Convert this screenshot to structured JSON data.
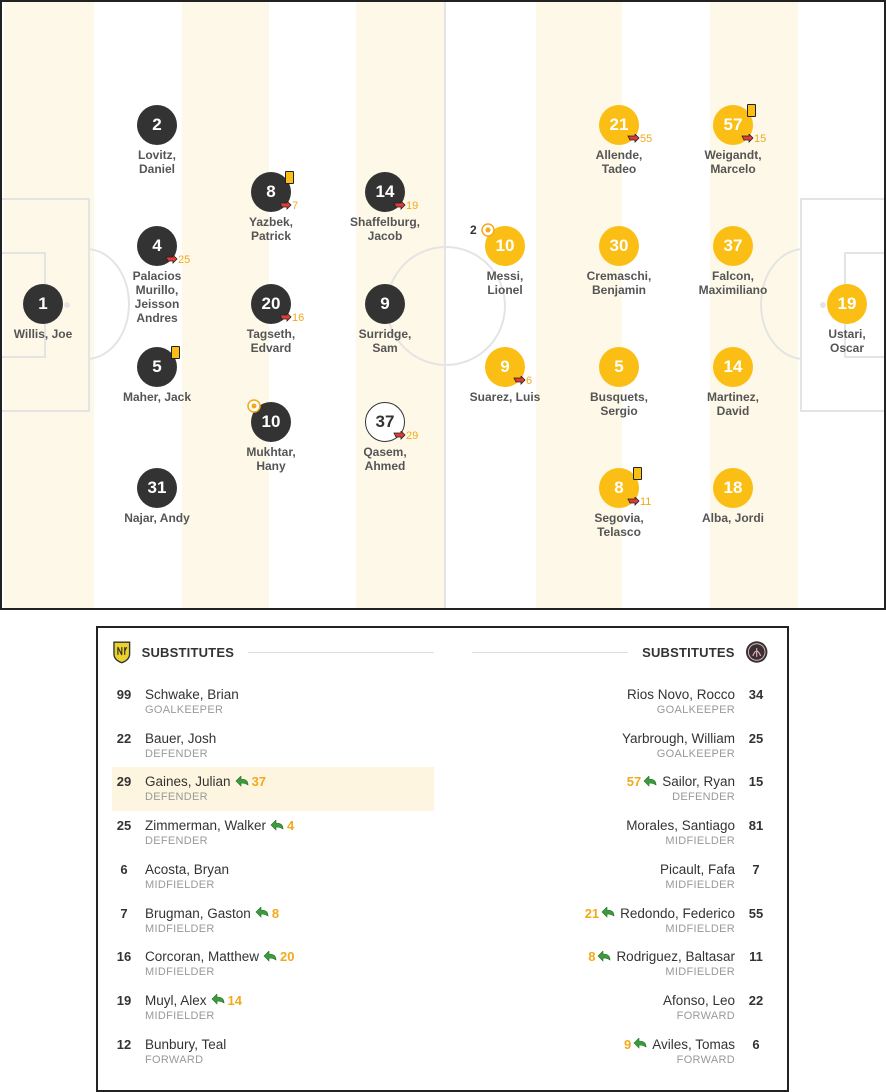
{
  "home_players": [
    {
      "number": "1",
      "name1": "Willis, Joe",
      "name2": ""
    },
    {
      "number": "2",
      "name1": "Lovitz,",
      "name2": "Daniel"
    },
    {
      "number": "4",
      "name1": "Palacios",
      "name2": "Murillo,",
      "name3": "Jeisson",
      "name4": "Andres",
      "sub_out": "25"
    },
    {
      "number": "5",
      "name1": "Maher, Jack",
      "name2": ""
    },
    {
      "number": "31",
      "name1": "Najar, Andy",
      "name2": ""
    },
    {
      "number": "8",
      "name1": "Yazbek,",
      "name2": "Patrick",
      "sub_out": "7"
    },
    {
      "number": "20",
      "name1": "Tagseth,",
      "name2": "Edvard",
      "sub_out": "16"
    },
    {
      "number": "10",
      "name1": "Mukhtar,",
      "name2": "Hany"
    },
    {
      "number": "14",
      "name1": "Shaffelburg,",
      "name2": "Jacob",
      "sub_out": "19"
    },
    {
      "number": "9",
      "name1": "Surridge,",
      "name2": "Sam"
    },
    {
      "number": "37",
      "name1": "Qasem,",
      "name2": "Ahmed",
      "sub_out": "29"
    }
  ],
  "away_players": [
    {
      "number": "10",
      "name1": "Messi,",
      "name2": "Lionel",
      "goals": "2"
    },
    {
      "number": "9",
      "name1": "Suarez, Luis",
      "name2": "",
      "sub_out": "6"
    },
    {
      "number": "21",
      "name1": "Allende,",
      "name2": "Tadeo",
      "sub_out": "55"
    },
    {
      "number": "30",
      "name1": "Cremaschi,",
      "name2": "Benjamin"
    },
    {
      "number": "5",
      "name1": "Busquets,",
      "name2": "Sergio"
    },
    {
      "number": "8",
      "name1": "Segovia,",
      "name2": "Telasco",
      "sub_out": "11"
    },
    {
      "number": "57",
      "name1": "Weigandt,",
      "name2": "Marcelo",
      "sub_out": "15"
    },
    {
      "number": "37",
      "name1": "Falcon,",
      "name2": "Maximiliano"
    },
    {
      "number": "14",
      "name1": "Martinez,",
      "name2": "David"
    },
    {
      "number": "18",
      "name1": "Alba, Jordi",
      "name2": ""
    },
    {
      "number": "19",
      "name1": "Ustari,",
      "name2": "Oscar"
    }
  ],
  "substitutes": {
    "home_title": "SUBSTITUTES",
    "away_title": "SUBSTITUTES",
    "home": [
      {
        "number": "99",
        "name": "Schwake, Brian",
        "position": "GOALKEEPER",
        "in_for": ""
      },
      {
        "number": "22",
        "name": "Bauer, Josh",
        "position": "DEFENDER",
        "in_for": ""
      },
      {
        "number": "29",
        "name": "Gaines, Julian",
        "position": "DEFENDER",
        "in_for": "37"
      },
      {
        "number": "25",
        "name": "Zimmerman, Walker",
        "position": "DEFENDER",
        "in_for": "4"
      },
      {
        "number": "6",
        "name": "Acosta, Bryan",
        "position": "MIDFIELDER",
        "in_for": ""
      },
      {
        "number": "7",
        "name": "Brugman, Gaston",
        "position": "MIDFIELDER",
        "in_for": "8"
      },
      {
        "number": "16",
        "name": "Corcoran, Matthew",
        "position": "MIDFIELDER",
        "in_for": "20"
      },
      {
        "number": "19",
        "name": "Muyl, Alex",
        "position": "MIDFIELDER",
        "in_for": "14"
      },
      {
        "number": "12",
        "name": "Bunbury, Teal",
        "position": "FORWARD",
        "in_for": ""
      }
    ],
    "away": [
      {
        "number": "34",
        "name": "Rios Novo, Rocco",
        "position": "GOALKEEPER",
        "in_for": ""
      },
      {
        "number": "25",
        "name": "Yarbrough, William",
        "position": "GOALKEEPER",
        "in_for": ""
      },
      {
        "number": "15",
        "name": "Sailor, Ryan",
        "position": "DEFENDER",
        "in_for": "57"
      },
      {
        "number": "81",
        "name": "Morales, Santiago",
        "position": "MIDFIELDER",
        "in_for": ""
      },
      {
        "number": "7",
        "name": "Picault, Fafa",
        "position": "MIDFIELDER",
        "in_for": ""
      },
      {
        "number": "55",
        "name": "Redondo, Federico",
        "position": "MIDFIELDER",
        "in_for": "21"
      },
      {
        "number": "11",
        "name": "Rodriguez, Baltasar",
        "position": "MIDFIELDER",
        "in_for": "8"
      },
      {
        "number": "22",
        "name": "Afonso, Leo",
        "position": "FORWARD",
        "in_for": ""
      },
      {
        "number": "6",
        "name": "Aviles, Tomas",
        "position": "FORWARD",
        "in_for": "9"
      }
    ]
  },
  "colors": {
    "home": "#333333",
    "away": "#fbbe14",
    "accent": "#f2a91a",
    "sub_in_arrow": "#3c9b3c",
    "sub_out_arrow": "#e03a3a"
  }
}
